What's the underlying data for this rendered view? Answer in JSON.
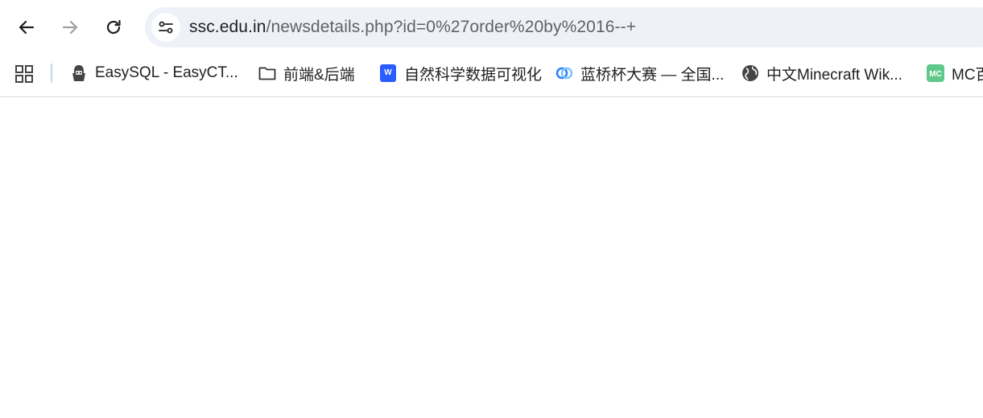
{
  "browser": {
    "nav": {
      "back_icon": "arrow-left-icon",
      "forward_icon": "arrow-right-icon",
      "reload_icon": "reload-icon"
    },
    "address_bar": {
      "site_info_icon": "tune-icon",
      "host": "ssc.edu.in",
      "path": "/newsdetails.php?id=0%27order%20by%2016--+"
    },
    "bookmarks": [
      {
        "label": "EasySQL - EasyCT...",
        "icon": "hacker-icon"
      },
      {
        "label": "前端&后端",
        "icon": "folder-icon"
      },
      {
        "label": "自然科学数据可视化",
        "icon": "word-doc-icon"
      },
      {
        "label": "蓝桥杯大赛 — 全国...",
        "icon": "lanqiao-logo-icon"
      },
      {
        "label": "中文Minecraft Wik...",
        "icon": "globe-icon"
      },
      {
        "label": "MC百",
        "icon": "mc-logo-icon"
      }
    ],
    "apps_icon": "apps-grid-icon",
    "colors": {
      "omnibox_bg": "#eef1f8",
      "word_blue": "#2b5cff",
      "mc_green": "#5fc98a"
    }
  }
}
